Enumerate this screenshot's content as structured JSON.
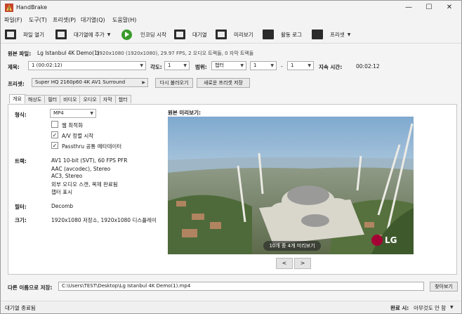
{
  "window": {
    "title": "HandBrake",
    "icon": "handbrake-icon"
  },
  "menu": [
    "파일(F)",
    "도구(T)",
    "프리셋(P)",
    "대기열(Q)",
    "도움말(H)"
  ],
  "toolbar": {
    "open_source": "파일 열기",
    "add_to_queue": "대기열에 추가",
    "start_encode": "인코딩 시작",
    "queue": "대기열",
    "preview": "미리보기",
    "activity_log": "활동 로그",
    "presets": "프리셋"
  },
  "source": {
    "label": "원본 파일:",
    "name": "Lg Istanbul 4K Demo(1)",
    "info": "1920x1080 (1920x1080), 29.97 FPS, 2 오디오 트랙들, 0 자막 트랙들"
  },
  "title_row": {
    "title_label": "제목:",
    "title_value": "1  (00:02:12)",
    "angle_label": "각도:",
    "angle_value": "1",
    "range_label": "범위:",
    "range_type": "챕터",
    "range_start": "1",
    "range_sep": "-",
    "range_end": "1",
    "duration_label": "지속 시간:",
    "duration_value": "00:02:12"
  },
  "preset_row": {
    "label": "프리셋:",
    "value": "Super HQ 2160p60 4K AV1 Surround",
    "reload": "다시 불러오기",
    "save_new": "새로운 프리셋 저장"
  },
  "tabs": [
    "개요",
    "해상도",
    "필터",
    "비디오",
    "오디오",
    "자막",
    "챕터"
  ],
  "summary": {
    "format_label": "형식:",
    "format_value": "MP4",
    "options": [
      {
        "label": "웹 최적화",
        "checked": false
      },
      {
        "label": "A/V 정렬 시작",
        "checked": true
      },
      {
        "label": "Passthru 공통 메타데이터",
        "checked": true
      }
    ],
    "tracks_label": "트랙:",
    "tracks": [
      "AV1 10-bit (SVT), 60 FPS PFR",
      "AAC (avcodec), Stereo",
      "AC3, Stereo",
      "외부 오디오 스캔, 복제 완료됨",
      "챕터 표시"
    ],
    "filters_label": "필터:",
    "filters_value": "Decomb",
    "size_label": "크기:",
    "size_value": "1920x1080 저장소, 1920x1080 디스플레이",
    "preview_label": "원본 미리보기:",
    "preview_caption": "10개 중 4개 미리보기",
    "logo": "LG",
    "prev": "<",
    "next": ">"
  },
  "destination": {
    "label": "다른 이름으로 저장:",
    "path": "C:\\Users\\TEST\\Desktop\\Lg Istanbul 4K Demo(1).mp4",
    "browse": "찾아보기"
  },
  "status": {
    "left": "대기열 종료됨",
    "when_done_label": "완료 시:",
    "when_done_value": "아무것도 안 함"
  }
}
